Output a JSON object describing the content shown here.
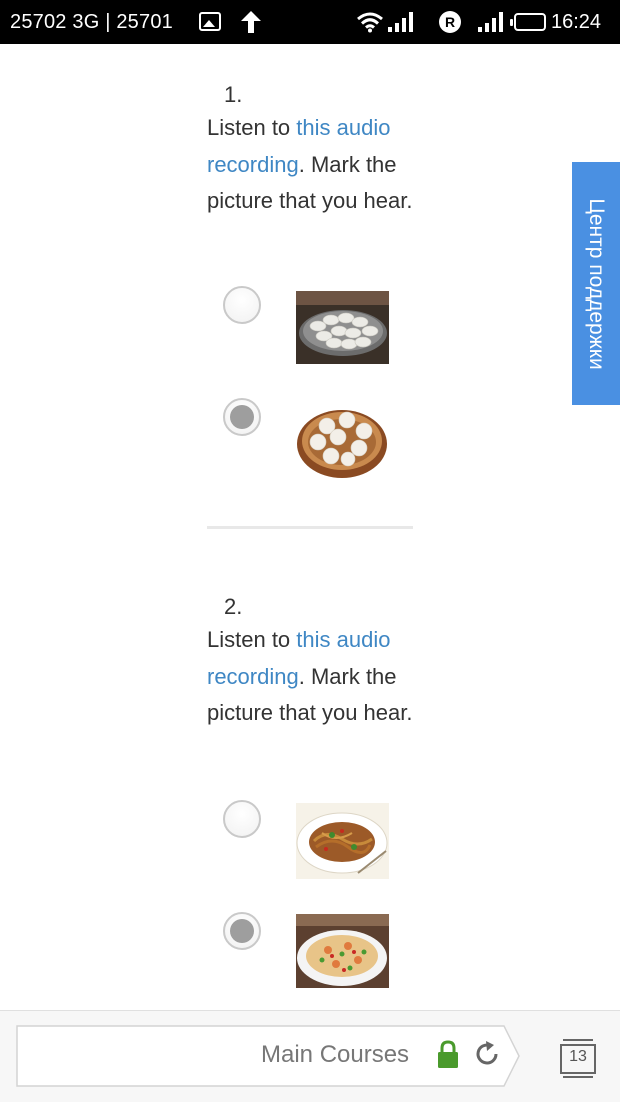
{
  "status_bar": {
    "carrier_text": "25702 3G | 25701",
    "r_badge": "R",
    "time": "16:24",
    "icons": [
      "image-icon",
      "upload-arrow-icon",
      "wifi-icon",
      "signal-icon",
      "r-badge-icon",
      "signal-icon",
      "battery-icon"
    ]
  },
  "questions": [
    {
      "number": "1.",
      "text_before": "Listen to ",
      "link_text": "this audio recording",
      "text_after": ". Mark the picture that you hear.",
      "options": [
        {
          "selected": false,
          "image": "dumplings-plate"
        },
        {
          "selected": true,
          "image": "steamed-buns-basket"
        }
      ]
    },
    {
      "number": "2.",
      "text_before": "Listen to ",
      "link_text": "this audio recording",
      "text_after": ". Mark the picture that you hear.",
      "options": [
        {
          "selected": false,
          "image": "noodles-plate"
        },
        {
          "selected": true,
          "image": "fried-rice-plate"
        }
      ]
    }
  ],
  "support_tab": {
    "label": "Центр поддержки"
  },
  "browser_bar": {
    "title": "Main Courses",
    "tab_count": "13"
  },
  "colors": {
    "link": "#3f87c4",
    "support_tab": "#4a90e2",
    "lock": "#4a9a2c",
    "status_bar": "#000000"
  }
}
